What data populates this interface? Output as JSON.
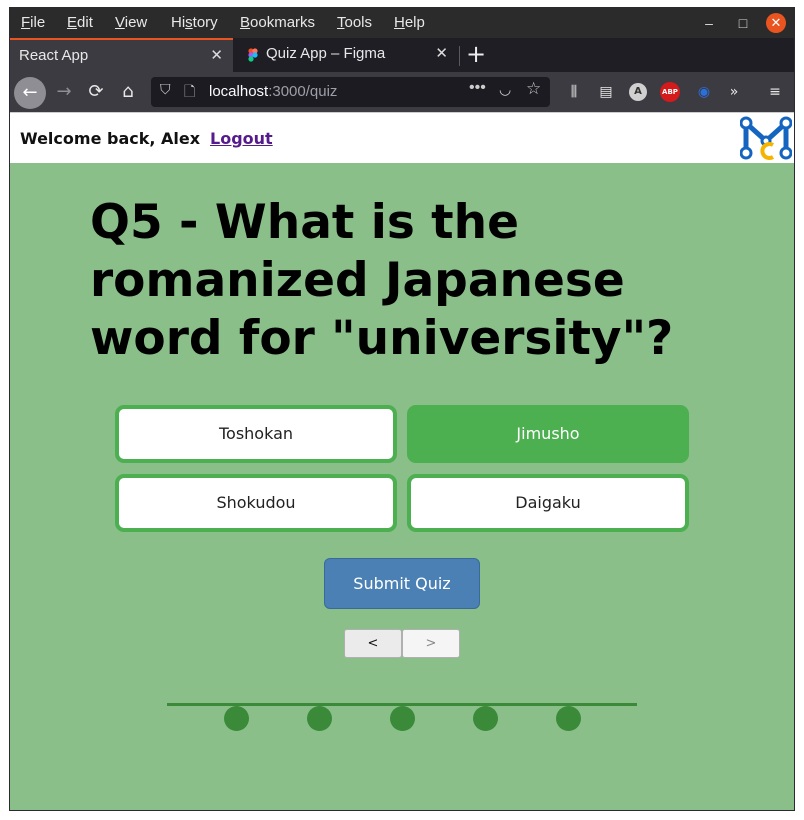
{
  "browser": {
    "menu": [
      "File",
      "Edit",
      "View",
      "History",
      "Bookmarks",
      "Tools",
      "Help"
    ],
    "menu_mnemonic": [
      "F",
      "E",
      "V",
      "s",
      "B",
      "T",
      "H"
    ],
    "tabs": [
      {
        "label": "React App",
        "active": true
      },
      {
        "label": "Quiz App – Figma",
        "active": false
      }
    ],
    "url_host": "localhost",
    "url_path": ":3000/quiz"
  },
  "header": {
    "welcome": "Welcome back, Alex",
    "logout": "Logout"
  },
  "quiz": {
    "question": "Q5 - What is the romanized Japanese word for \"university\"?",
    "options": [
      {
        "label": "Toshokan",
        "selected": false
      },
      {
        "label": "Jimusho",
        "selected": true
      },
      {
        "label": "Shokudou",
        "selected": false
      },
      {
        "label": "Daigaku",
        "selected": false
      }
    ],
    "submit": "Submit Quiz",
    "prev": "<",
    "next": ">",
    "progress_steps": 5
  },
  "colors": {
    "page_bg": "#8abf8a",
    "accent_green": "#4caf50",
    "submit_blue": "#4a80b4",
    "progress_green": "#3a8a3a",
    "logout_purple": "#551a8b"
  }
}
